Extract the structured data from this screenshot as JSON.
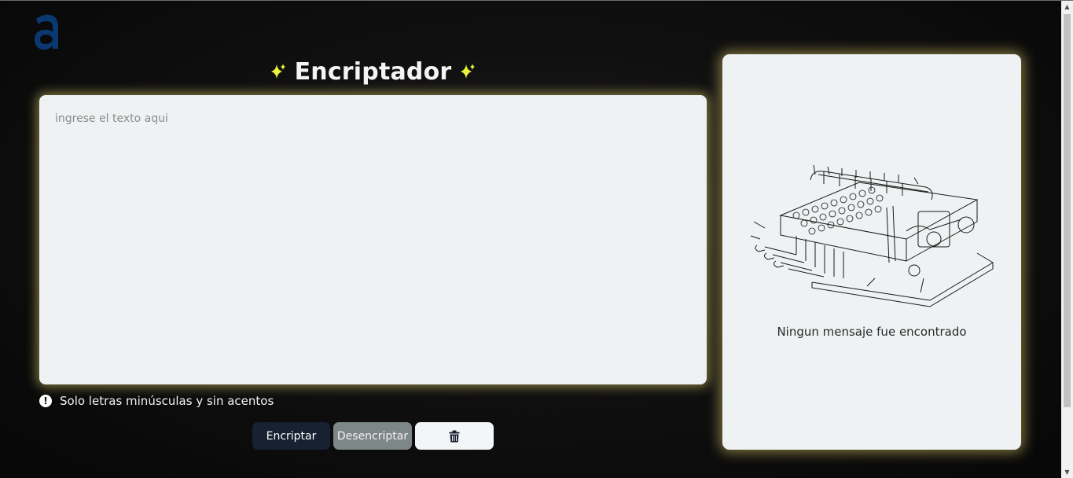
{
  "logo": {
    "icon": "alura-logo-icon",
    "color": "#0a3871"
  },
  "header": {
    "title": "Encriptador",
    "sparkle_color": "#e9f53c"
  },
  "editor": {
    "placeholder": "ingrese el texto aqui",
    "value": ""
  },
  "hint": {
    "icon": "exclamation-icon",
    "text": "Solo letras minúsculas y sin acentos"
  },
  "buttons": {
    "encrypt_label": "Encriptar",
    "decrypt_label": "Desencriptar",
    "clear_icon": "trash-icon"
  },
  "output": {
    "illustration": "cipher-machine-drawing",
    "message": "Ningun mensaje fue encontrado"
  },
  "colors": {
    "background": "#0b0b0b",
    "card": "#eff2f3",
    "glow": "#ebd76e",
    "primary_button": "#172131",
    "secondary_button": "#7e8787"
  }
}
